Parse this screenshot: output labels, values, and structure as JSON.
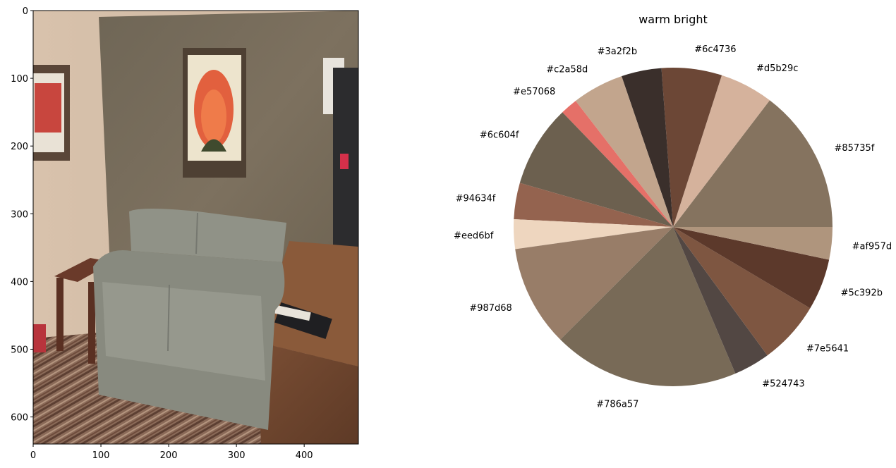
{
  "chart_data": [
    {
      "type": "image",
      "xticks": [
        0,
        100,
        200,
        300,
        400
      ],
      "yticks": [
        0,
        100,
        200,
        300,
        400,
        500,
        600
      ],
      "xlim": [
        0,
        480
      ],
      "ylim": [
        640,
        0
      ],
      "y_inverted": true
    },
    {
      "type": "pie",
      "title": "warm bright",
      "start_angle_deg": 0,
      "direction": "counterclockwise",
      "slices": [
        {
          "label": "#85735f",
          "value": 15.1,
          "color": "#85735f"
        },
        {
          "label": "#d5b29c",
          "value": 5.6,
          "color": "#d5b29c"
        },
        {
          "label": "#6c4736",
          "value": 6.3,
          "color": "#6c4736"
        },
        {
          "label": "#3a2f2b",
          "value": 4.2,
          "color": "#3a2f2b"
        },
        {
          "label": "#c2a58d",
          "value": 5.4,
          "color": "#c2a58d"
        },
        {
          "label": "#e57068",
          "value": 1.8,
          "color": "#e57068"
        },
        {
          "label": "#6c604f",
          "value": 8.6,
          "color": "#6c604f"
        },
        {
          "label": "#94634f",
          "value": 3.8,
          "color": "#94634f"
        },
        {
          "label": "#eed6bf",
          "value": 3.1,
          "color": "#eed6bf"
        },
        {
          "label": "#987d68",
          "value": 10.6,
          "color": "#987d68"
        },
        {
          "label": "#786a57",
          "value": 19.5,
          "color": "#786a57"
        },
        {
          "label": "#524743",
          "value": 3.8,
          "color": "#524743"
        },
        {
          "label": "#7e5641",
          "value": 6.6,
          "color": "#7e5641"
        },
        {
          "label": "#5c392b",
          "value": 5.4,
          "color": "#5c392b"
        },
        {
          "label": "#af957d",
          "value": 3.4,
          "color": "#af957d"
        }
      ]
    }
  ]
}
